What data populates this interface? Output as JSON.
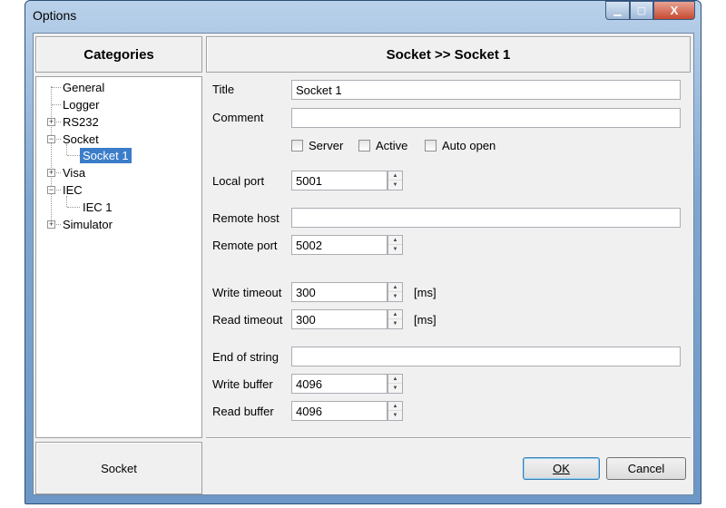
{
  "window": {
    "title": "Options",
    "controls": {
      "minimize": "minimize-icon",
      "maximize": "maximize-icon",
      "close": "X"
    }
  },
  "categories": {
    "header": "Categories",
    "footer": "Socket",
    "tree": [
      {
        "label": "General",
        "expander": "none"
      },
      {
        "label": "Logger",
        "expander": "none"
      },
      {
        "label": "RS232",
        "expander": "+"
      },
      {
        "label": "Socket",
        "expander": "-"
      },
      {
        "label": "Socket 1",
        "expander": "none",
        "selected": true
      },
      {
        "label": "Visa",
        "expander": "+"
      },
      {
        "label": "IEC",
        "expander": "-"
      },
      {
        "label": "IEC 1",
        "expander": "none"
      },
      {
        "label": "Simulator",
        "expander": "+"
      }
    ]
  },
  "panel": {
    "header": "Socket >> Socket 1",
    "title_label": "Title",
    "title_value": "Socket 1",
    "comment_label": "Comment",
    "comment_value": "",
    "server_label": "Server",
    "active_label": "Active",
    "auto_open_label": "Auto open",
    "server": false,
    "active": false,
    "auto_open": false,
    "local_port_label": "Local port",
    "local_port": "5001",
    "remote_host_label": "Remote host",
    "remote_host": "",
    "remote_port_label": "Remote port",
    "remote_port": "5002",
    "write_timeout_label": "Write timeout",
    "write_timeout": "300",
    "read_timeout_label": "Read timeout",
    "read_timeout": "300",
    "unit": "[ms]",
    "eos_label": "End of string",
    "eos": "",
    "write_buffer_label": "Write buffer",
    "write_buffer": "4096",
    "read_buffer_label": "Read buffer",
    "read_buffer": "4096"
  },
  "buttons": {
    "ok": "OK",
    "cancel": "Cancel"
  }
}
